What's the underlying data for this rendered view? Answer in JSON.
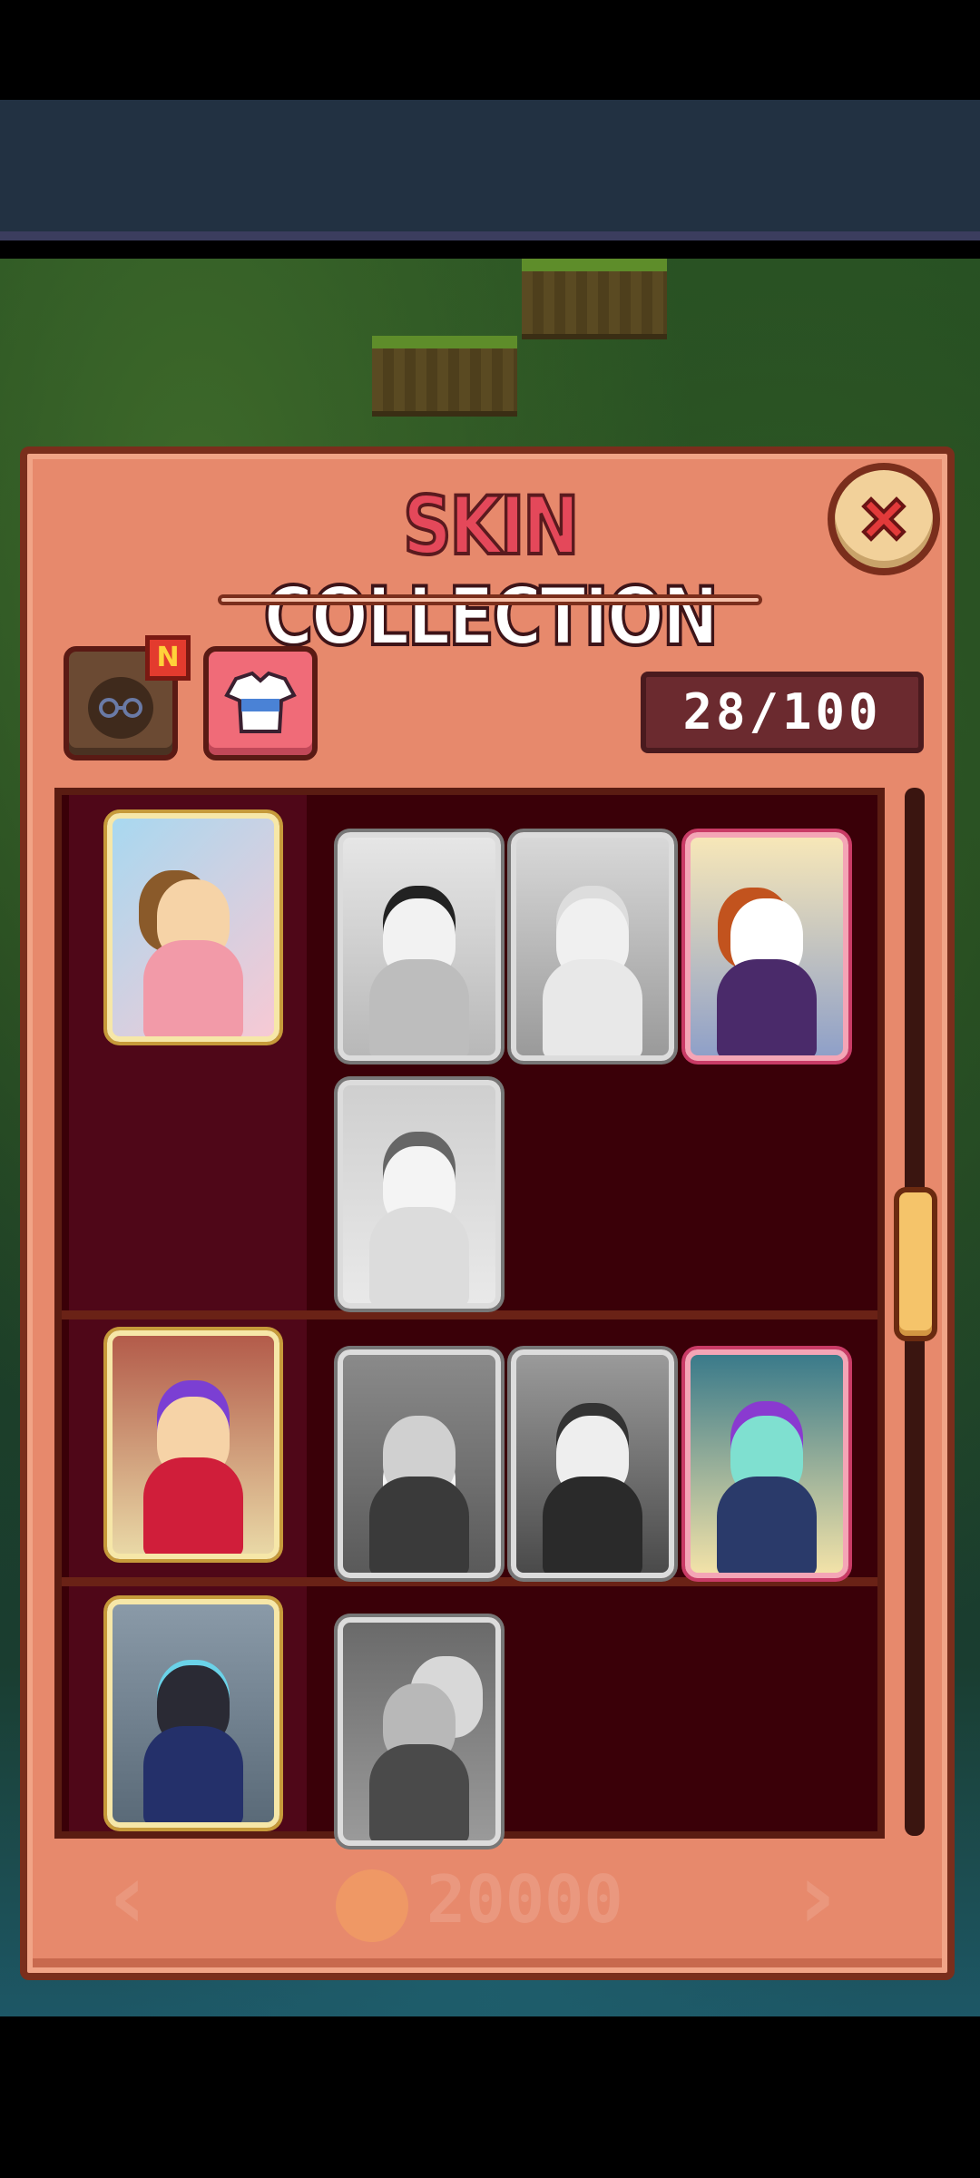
{
  "title": {
    "part1": "SKIN",
    "part2": "COLLECTION"
  },
  "counter": "28/100",
  "new_badge": "N",
  "background_ghost": {
    "price": "20000"
  },
  "tabs": [
    {
      "name": "character-tab",
      "icon": "character-face-icon"
    },
    {
      "name": "outfit-tab",
      "icon": "shirt-icon"
    }
  ],
  "rows": [
    {
      "main": {
        "state": "unlocked",
        "skin": "ballerina"
      },
      "variants": [
        {
          "state": "locked",
          "skin": "dark-hair-girl"
        },
        {
          "state": "locked",
          "skin": "fluffy-hair-girl"
        },
        {
          "state": "rare",
          "skin": "robot-girl"
        },
        {
          "state": "locked",
          "skin": "swirl-hair-girl"
        }
      ]
    },
    {
      "main": {
        "state": "unlocked",
        "skin": "purple-hair-dancer"
      },
      "variants": [
        {
          "state": "locked",
          "skin": "bearded-master"
        },
        {
          "state": "locked",
          "skin": "long-hair-girl"
        },
        {
          "state": "rare",
          "skin": "cyber-girl"
        }
      ]
    },
    {
      "main": {
        "state": "unlocked",
        "skin": "swat-soldier"
      },
      "variants": [
        {
          "state": "locked",
          "skin": "tank-soldier"
        }
      ]
    }
  ],
  "colors": {
    "panel": "#e7896c",
    "title_red": "#e4485a",
    "list_bg": "#3a0008",
    "rare_border": "#c93b66",
    "locked_border": "#dcdcdc"
  }
}
